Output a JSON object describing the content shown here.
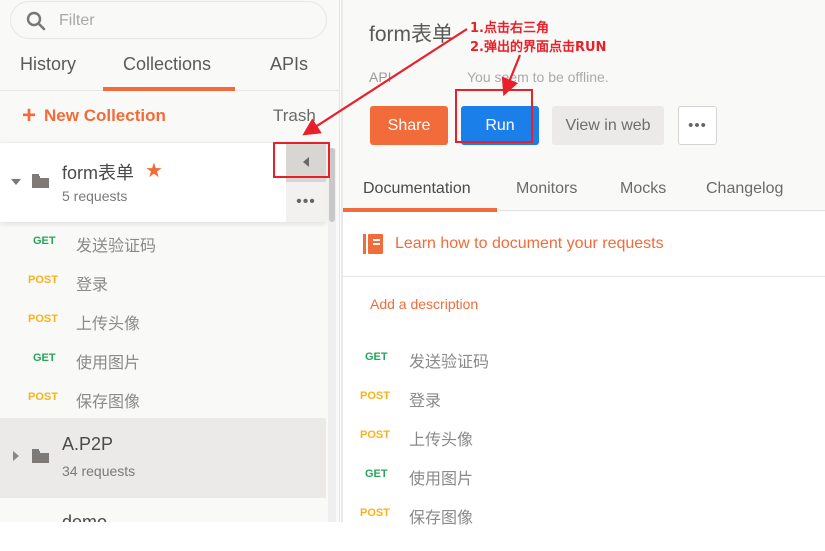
{
  "sidebar": {
    "search": {
      "placeholder": "Filter",
      "value": "",
      "icon": "search-icon"
    },
    "tabs": [
      {
        "label": "History",
        "active": false
      },
      {
        "label": "Collections",
        "active": true
      },
      {
        "label": "APIs",
        "active": false
      }
    ],
    "new_collection_label": "New Collection",
    "new_collection_icon": "+",
    "trash_label": "Trash",
    "collections": [
      {
        "name": "form表单",
        "count": "5 requests",
        "starred": true,
        "star_glyph": "★",
        "expanded": true,
        "requests": [
          {
            "method": "GET",
            "name": "发送验证码"
          },
          {
            "method": "POST",
            "name": "登录"
          },
          {
            "method": "POST",
            "name": "上传头像"
          },
          {
            "method": "GET",
            "name": "使用图片"
          },
          {
            "method": "POST",
            "name": "保存图像"
          }
        ]
      },
      {
        "name": "A.P2P",
        "count": "34 requests",
        "starred": false,
        "expanded": false
      },
      {
        "name": "demo",
        "count": "",
        "starred": false,
        "expanded": false
      }
    ],
    "more_glyph": "•••"
  },
  "main": {
    "title": "form表单",
    "api_label": "API",
    "offline_message": "You seem to be offline.",
    "buttons": {
      "share": "Share",
      "run": "Run",
      "view_in_web": "View in web",
      "more": "•••"
    },
    "tabs": [
      {
        "label": "Documentation",
        "active": true
      },
      {
        "label": "Monitors",
        "active": false
      },
      {
        "label": "Mocks",
        "active": false
      },
      {
        "label": "Changelog",
        "active": false
      }
    ],
    "learn_link": "Learn how to document your requests",
    "add_description": "Add a description",
    "requests": [
      {
        "method": "GET",
        "name": "发送验证码"
      },
      {
        "method": "POST",
        "name": "登录"
      },
      {
        "method": "POST",
        "name": "上传头像"
      },
      {
        "method": "GET",
        "name": "使用图片"
      },
      {
        "method": "POST",
        "name": "保存图像"
      }
    ]
  },
  "annotations": {
    "step1": "1.点击右三角",
    "step2": "2.弹出的界面点击RUN",
    "color": "#e8202a"
  },
  "colors": {
    "accent": "#f26b3a",
    "run_blue": "#1a7fe8",
    "get_green": "#26a65b",
    "post_yellow": "#f9b21a"
  }
}
